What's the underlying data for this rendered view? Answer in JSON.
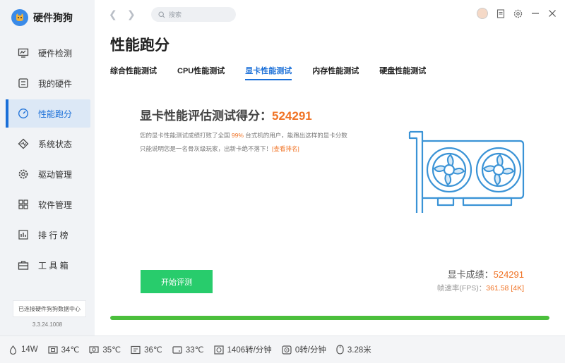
{
  "app": {
    "name": "硬件狗狗",
    "version": "3.3.24.1008",
    "connect_text": "已连接硬件狗狗数据中心"
  },
  "sidebar": {
    "items": [
      {
        "label": "硬件检测",
        "icon": "monitor-icon"
      },
      {
        "label": "我的硬件",
        "icon": "hardware-icon"
      },
      {
        "label": "性能跑分",
        "icon": "speedometer-icon",
        "active": true
      },
      {
        "label": "系统状态",
        "icon": "diamond-icon"
      },
      {
        "label": "驱动管理",
        "icon": "gear-icon"
      },
      {
        "label": "软件管理",
        "icon": "apps-icon"
      },
      {
        "label": "排 行 榜",
        "icon": "ranking-icon"
      },
      {
        "label": "工 具 箱",
        "icon": "toolbox-icon"
      }
    ]
  },
  "topbar": {
    "search_placeholder": "搜索"
  },
  "page": {
    "title": "性能跑分",
    "tabs": [
      "综合性能测试",
      "CPU性能测试",
      "显卡性能测试",
      "内存性能测试",
      "硬盘性能测试"
    ],
    "active_tab": 2
  },
  "score": {
    "title_prefix": "显卡性能评估测试得分：",
    "value": "524291",
    "desc_part1": "您的显卡性能测试成绩打败了全国 ",
    "desc_percent": "99%",
    "desc_part2": " 台式机的用户，能跑出这样的显卡分数只能说明您是一名骨灰级玩家，出新卡绝不落下！",
    "desc_link": "[查看排名]"
  },
  "actions": {
    "start_label": "开始评测"
  },
  "result": {
    "score_label": "显卡成绩：",
    "score_value": "524291",
    "fps_label": "帧速率(FPS)：",
    "fps_value": "361.58 [4K]"
  },
  "progress": {
    "percent": 100,
    "color": "#4bbf3c"
  },
  "statusbar": [
    {
      "icon": "power-icon",
      "text": "14W"
    },
    {
      "icon": "cpu-temp-icon",
      "text": "34℃"
    },
    {
      "icon": "gpu-temp-icon",
      "text": "35℃"
    },
    {
      "icon": "board-temp-icon",
      "text": "36℃"
    },
    {
      "icon": "disk-temp-icon",
      "text": "33℃"
    },
    {
      "icon": "cpu-fan-icon",
      "text": "1406转/分钟"
    },
    {
      "icon": "gpu-fan-icon",
      "text": "0转/分钟"
    },
    {
      "icon": "mouse-icon",
      "text": "3.28米"
    }
  ],
  "colors": {
    "accent": "#1a6fd8",
    "score": "#f07325",
    "start_button": "#28cc6c",
    "gpu_illustration": "#3a93d6"
  }
}
